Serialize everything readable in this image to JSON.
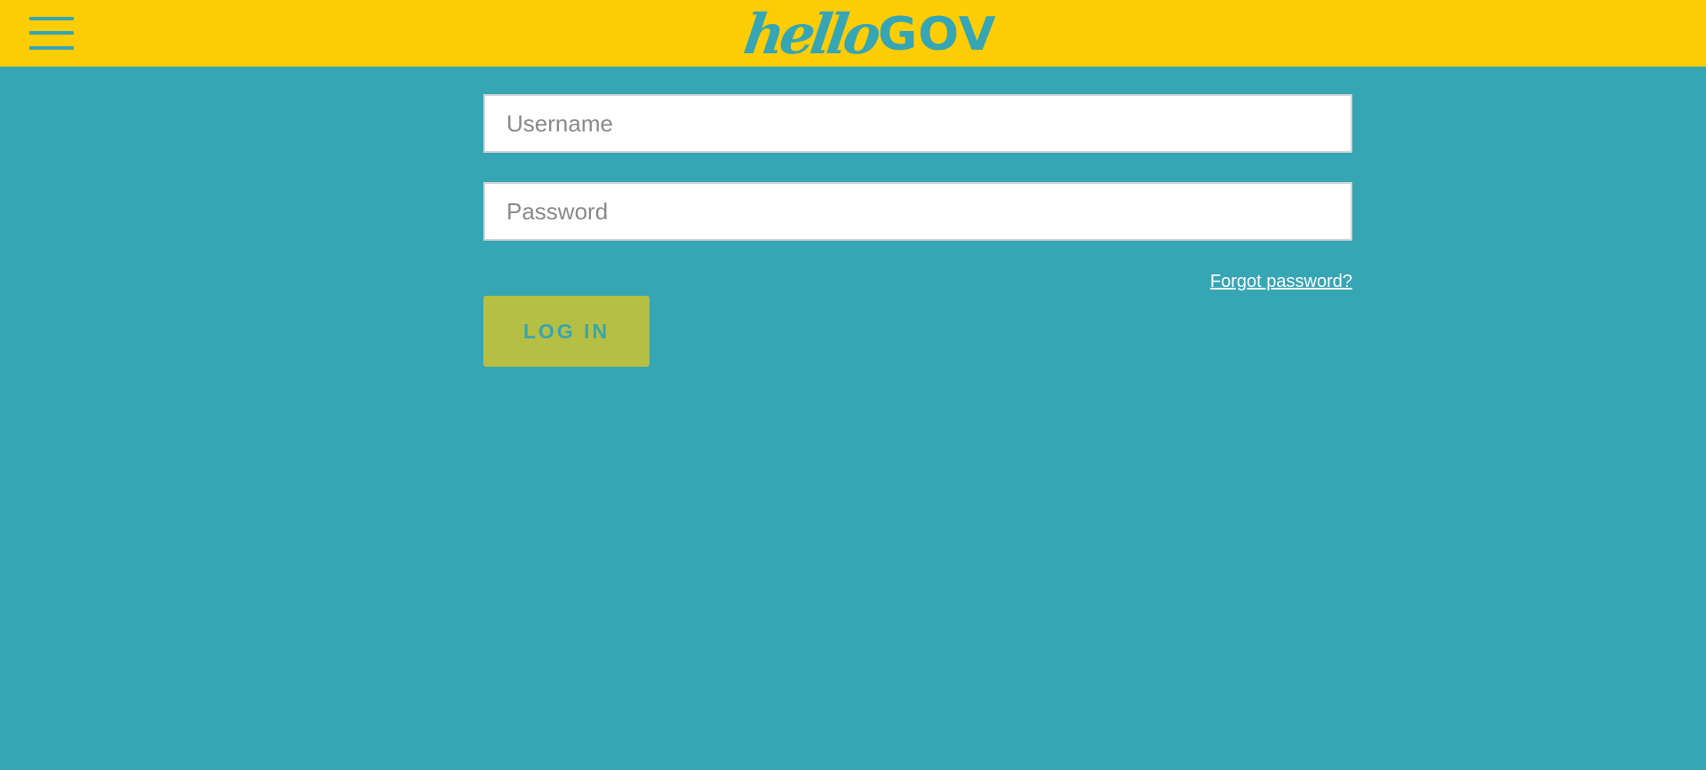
{
  "header": {
    "menu_icon": "hamburger-menu-icon",
    "logo": {
      "part1": "hello",
      "part2": "GOV"
    }
  },
  "login_form": {
    "username": {
      "value": "",
      "placeholder": "Username"
    },
    "password": {
      "value": "",
      "placeholder": "Password"
    },
    "forgot_password_label": "Forgot password?",
    "login_label": "LOG IN"
  },
  "colors": {
    "header_background": "#fecd06",
    "page_background": "#36a5b4",
    "brand_accent": "#36a5b4",
    "button_background": "#b5bf43",
    "field_border": "#d3d3d3",
    "link_color": "#ffffff"
  }
}
